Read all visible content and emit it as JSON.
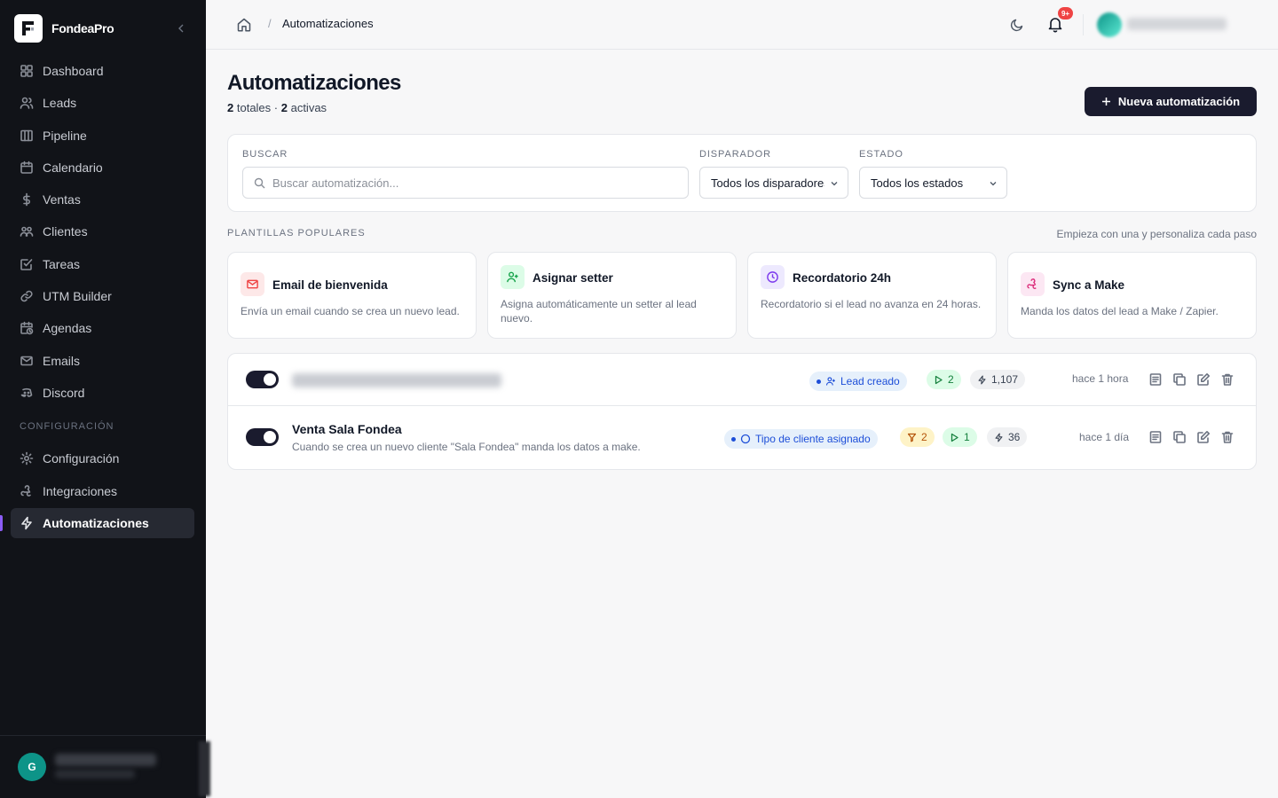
{
  "app": {
    "name": "FondeaPro",
    "user_avatar_letter": "G"
  },
  "sidebar": {
    "items": [
      {
        "label": "Dashboard",
        "icon": "dashboard-icon"
      },
      {
        "label": "Leads",
        "icon": "users-icon"
      },
      {
        "label": "Pipeline",
        "icon": "columns-icon"
      },
      {
        "label": "Calendario",
        "icon": "calendar-icon"
      },
      {
        "label": "Ventas",
        "icon": "dollar-icon"
      },
      {
        "label": "Clientes",
        "icon": "clients-icon"
      },
      {
        "label": "Tareas",
        "icon": "tasks-icon"
      },
      {
        "label": "UTM Builder",
        "icon": "link-icon"
      },
      {
        "label": "Agendas",
        "icon": "calendar-clock-icon"
      },
      {
        "label": "Emails",
        "icon": "mail-icon"
      },
      {
        "label": "Discord",
        "icon": "discord-icon"
      }
    ],
    "section_label": "CONFIGURACIÓN",
    "config_items": [
      {
        "label": "Configuración",
        "icon": "gear-icon"
      },
      {
        "label": "Integraciones",
        "icon": "webhook-icon"
      },
      {
        "label": "Automatizaciones",
        "icon": "zap-icon",
        "active": true
      }
    ]
  },
  "topbar": {
    "breadcrumb_sep": "/",
    "breadcrumb_current": "Automatizaciones",
    "notification_count": "9+"
  },
  "header": {
    "title": "Automatizaciones",
    "total_count": "2",
    "total_label": "totales ·",
    "active_count": "2",
    "active_label": "activas",
    "new_button": "Nueva automatización"
  },
  "filters": {
    "search_label": "BUSCAR",
    "search_placeholder": "Buscar automatización...",
    "trigger_label": "DISPARADOR",
    "trigger_value": "Todos los disparadores",
    "status_label": "ESTADO",
    "status_value": "Todos los estados"
  },
  "templates": {
    "label": "PLANTILLAS POPULARES",
    "hint": "Empieza con una y personaliza cada paso",
    "items": [
      {
        "title": "Email de bienvenida",
        "desc": "Envía un email cuando se crea un nuevo lead.",
        "icon": "mail-icon",
        "color": "#ef4444",
        "bg": "#fde8e8"
      },
      {
        "title": "Asignar setter",
        "desc": "Asigna automáticamente un setter al lead nuevo.",
        "icon": "user-plus-icon",
        "color": "#16a34a",
        "bg": "#dcfce7"
      },
      {
        "title": "Recordatorio 24h",
        "desc": "Recordatorio si el lead no avanza en 24 horas.",
        "icon": "clock-icon",
        "color": "#7c3aed",
        "bg": "#ede9fe"
      },
      {
        "title": "Sync a Make",
        "desc": "Manda los datos del lead a Make / Zapier.",
        "icon": "webhook-icon",
        "color": "#db2777",
        "bg": "#fce7f3"
      }
    ]
  },
  "automations": [
    {
      "name": "",
      "desc": "",
      "enabled": true,
      "trigger": "Lead creado",
      "filters": "",
      "actions": "2",
      "runs": "1,107",
      "time": "hace 1 hora"
    },
    {
      "name": "Venta Sala Fondea",
      "desc": "Cuando se crea un nuevo cliente \"Sala Fondea\" manda los datos a make.",
      "enabled": true,
      "trigger": "Tipo de cliente asignado",
      "filters": "2",
      "actions": "1",
      "runs": "36",
      "time": "hace 1 día"
    }
  ]
}
